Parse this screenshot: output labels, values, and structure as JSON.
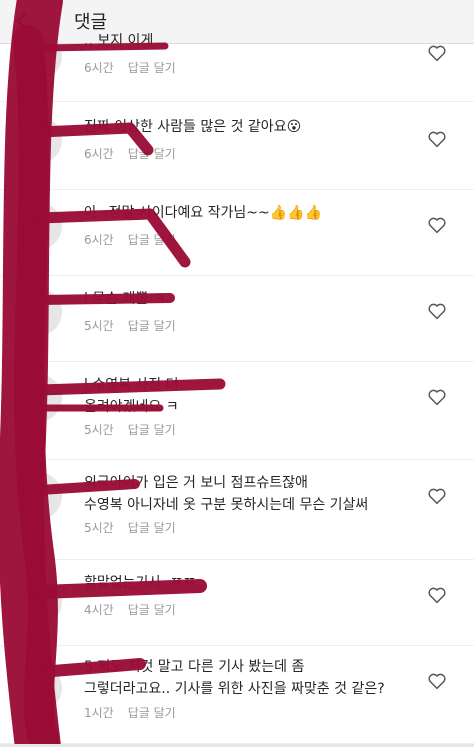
{
  "header": {
    "title": "댓글",
    "back_icon": "back-arrow-icon"
  },
  "comments": [
    {
      "text": ".. 보지 이게 ..",
      "time": "6시간",
      "reply": "답글 달기"
    },
    {
      "text": "진짜 이상한 사람들 많은 것 같아요😮",
      "time": "6시간",
      "reply": "답글 달기"
    },
    {
      "text": "아~정말 사이다예요 작가님~~👍👍👍",
      "time": "6시간",
      "reply": "답글 달기"
    },
    {
      "text": "l 무슨 개뿔 ㅋ",
      "time": "5시간",
      "reply": "답글 달기"
    },
    {
      "text": "l 수영복 사진 더\n올려야겠네요 ㅋ",
      "time": "5시간",
      "reply": "답글 달기"
    },
    {
      "text": "외국아이가 입은 거 보니 점프슈트잖애\n수영복 아니자네 옷 구분 못하시는데 무슨 기살써",
      "time": "5시간",
      "reply": "답글 달기"
    },
    {
      "text": "할말없는기사..ㅉㅉ",
      "time": "4시간",
      "reply": "답글 달기"
    },
    {
      "text": "5 저도 저것 말고 다른 기사 봤는데 좀\n그렇더라고요.. 기사를 위한 사진을 짜맞춘 것 같은?",
      "time": "1시간",
      "reply": "답글 달기"
    }
  ],
  "colors": {
    "redaction": "#9a0b36",
    "header_bg": "#f4f4f4",
    "meta": "#999999"
  }
}
